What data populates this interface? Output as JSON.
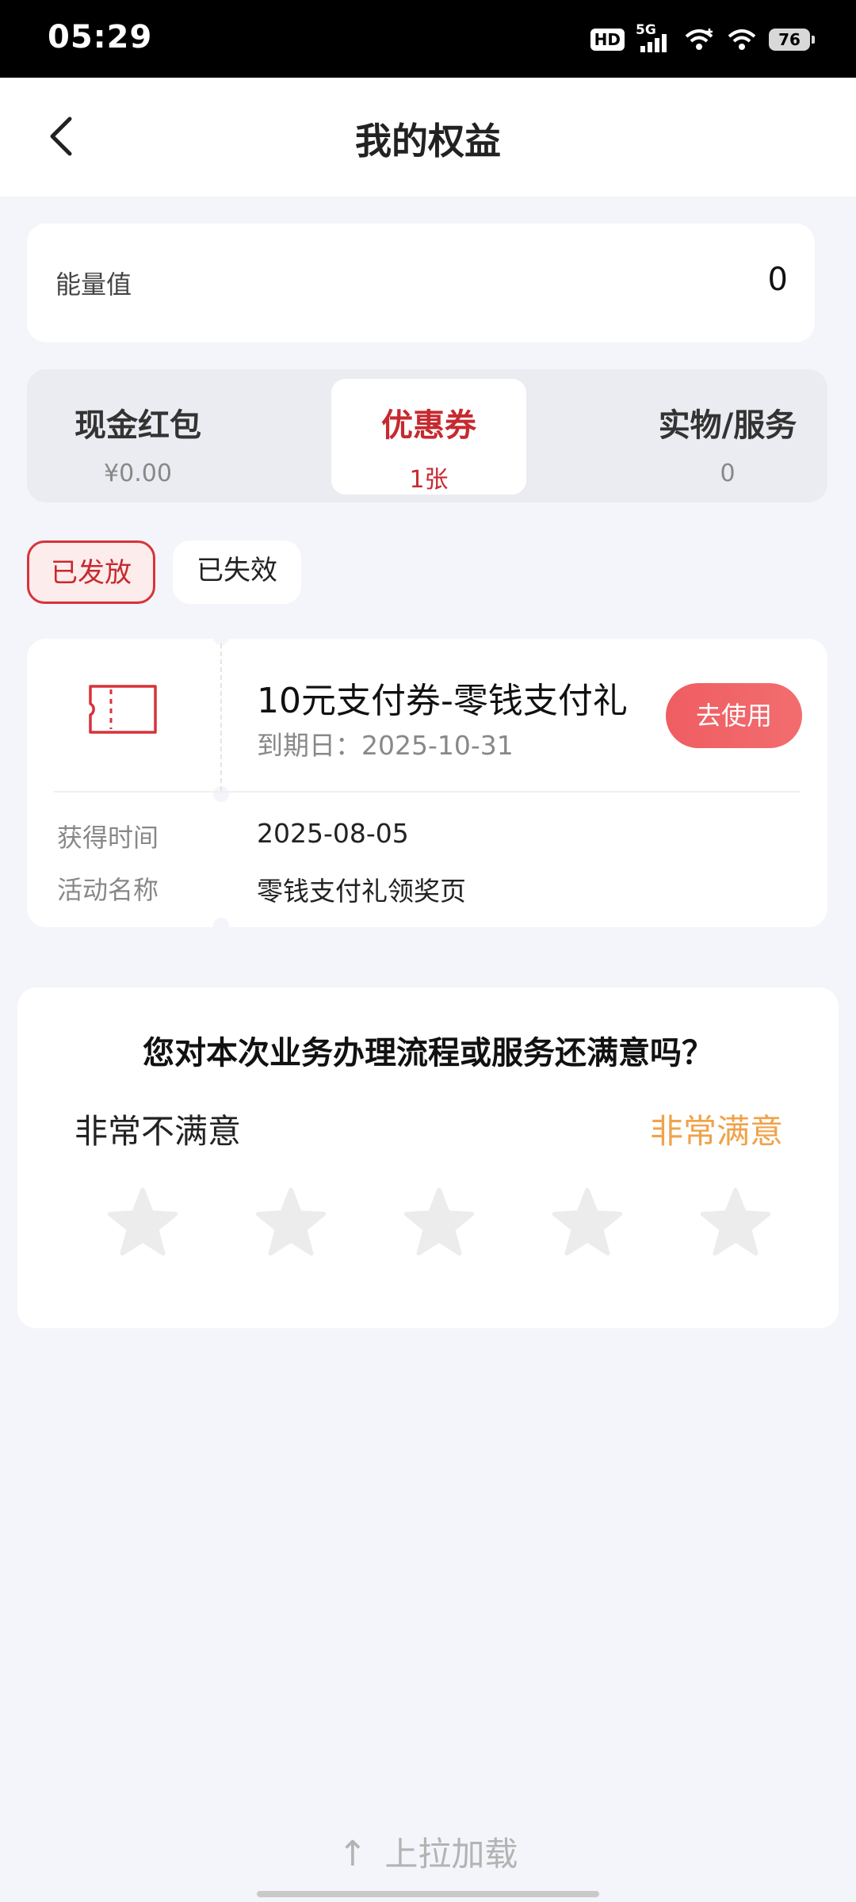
{
  "status_bar": {
    "time": "05:29",
    "hd_label": "HD",
    "network_label": "5G",
    "battery": "76"
  },
  "header": {
    "title": "我的权益"
  },
  "energy": {
    "label": "能量值",
    "value": "0"
  },
  "tabs": [
    {
      "title": "现金红包",
      "sub": "¥0.00",
      "active": false
    },
    {
      "title": "优惠券",
      "sub": "1张",
      "active": true
    },
    {
      "title": "实物/服务",
      "sub": "0",
      "active": false
    }
  ],
  "filters": [
    {
      "label": "已发放",
      "active": true
    },
    {
      "label": "已失效",
      "active": false
    }
  ],
  "coupon": {
    "name": "10元支付券-零钱支付礼",
    "expiry": "到期日：2025-10-31",
    "use_label": "去使用",
    "details": [
      {
        "key": "获得时间",
        "value": "2025-08-05"
      },
      {
        "key": "活动名称",
        "value": "零钱支付礼领奖页"
      }
    ]
  },
  "survey": {
    "question": "您对本次业务办理流程或服务还满意吗？",
    "low_label": "非常不满意",
    "high_label": "非常满意",
    "stars": 5,
    "selected": 0
  },
  "footer": {
    "load_more": "上拉加载"
  },
  "colors": {
    "accent": "#c62a2f",
    "button": "#ef5d62",
    "satisfied": "#f0a24a",
    "background": "#f4f5fa"
  }
}
